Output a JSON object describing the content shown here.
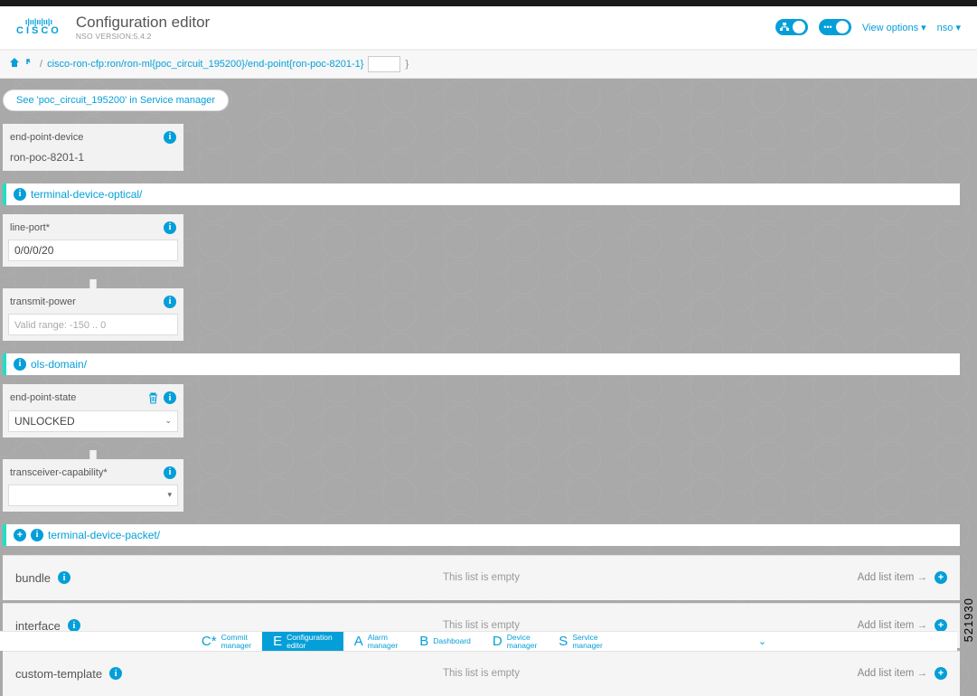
{
  "header": {
    "title": "Configuration editor",
    "subtitle": "NSO VERSION:5.4.2",
    "view_options": "View options ▾",
    "nso_menu": "nso ▾",
    "logo_text": "CISCO"
  },
  "breadcrumb": {
    "path": "cisco-ron-cfp:ron/ron-ml{poc_circuit_195200}/end-point{ron-poc-8201-1}",
    "trailing_brace": "}"
  },
  "service_link": "See 'poc_circuit_195200' in Service manager",
  "panel_device": {
    "label": "end-point-device",
    "value": "ron-poc-8201-1"
  },
  "section_terminal_optical": "terminal-device-optical/",
  "panel_line_port": {
    "label": "line-port*",
    "value": "0/0/0/20"
  },
  "panel_transmit_power": {
    "label": "transmit-power",
    "placeholder": "Valid range: -150 .. 0"
  },
  "section_ols": "ols-domain/",
  "panel_endpoint_state": {
    "label": "end-point-state",
    "value": "UNLOCKED"
  },
  "panel_transceiver": {
    "label": "transceiver-capability*",
    "value": ""
  },
  "section_terminal_packet": "terminal-device-packet/",
  "lists": [
    {
      "name": "bundle",
      "empty_text": "This list is empty",
      "add_text": "Add list item →"
    },
    {
      "name": "interface",
      "empty_text": "This list is empty",
      "add_text": "Add list item →"
    },
    {
      "name": "custom-template",
      "empty_text": "This list is empty",
      "add_text": "Add list item →"
    }
  ],
  "bottom_nav": [
    {
      "letter": "C*",
      "label": "Commit\nmanager"
    },
    {
      "letter": "E",
      "label": "Configuration\neditor"
    },
    {
      "letter": "A",
      "label": "Alarm\nmanager"
    },
    {
      "letter": "B",
      "label": "Dashboard"
    },
    {
      "letter": "D",
      "label": "Device\nmanager"
    },
    {
      "letter": "S",
      "label": "Service\nmanager"
    }
  ],
  "watermark": "521930"
}
